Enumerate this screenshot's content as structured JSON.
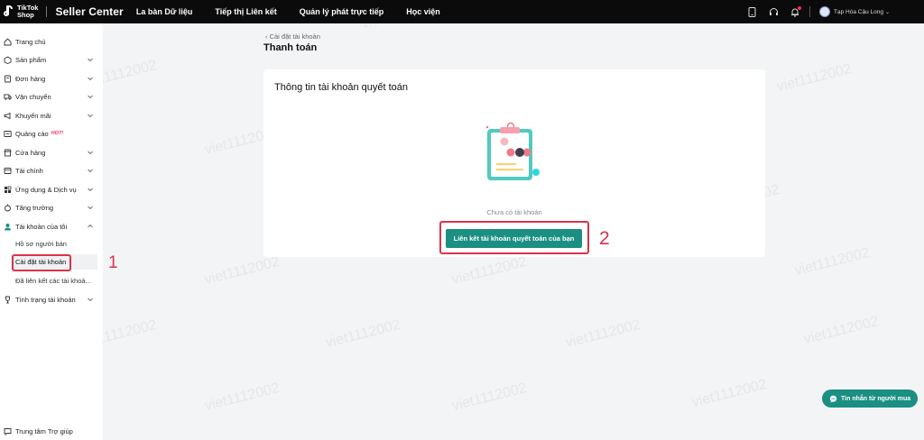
{
  "header": {
    "logo_line1": "TikTok",
    "logo_line2": "Shop",
    "brand_title": "Seller Center",
    "nav": [
      "La bàn Dữ liệu",
      "Tiếp thị Liên kết",
      "Quản lý phát trực tiếp",
      "Học viện"
    ],
    "user_name": "Tạp Hóa Cậu Long"
  },
  "sidebar": {
    "items": [
      {
        "label": "Trang chủ",
        "icon": "home-icon"
      },
      {
        "label": "Sản phẩm",
        "icon": "product-icon"
      },
      {
        "label": "Đơn hàng",
        "icon": "order-icon"
      },
      {
        "label": "Vận chuyển",
        "icon": "truck-icon"
      },
      {
        "label": "Khuyến mãi",
        "icon": "megaphone-icon"
      },
      {
        "label": "Quảng cáo",
        "icon": "ads-icon",
        "badge": "HOT!"
      },
      {
        "label": "Cửa hàng",
        "icon": "store-icon"
      },
      {
        "label": "Tài chính",
        "icon": "finance-icon"
      },
      {
        "label": "Ứng dụng & Dịch vụ",
        "icon": "apps-icon"
      },
      {
        "label": "Tăng trưởng",
        "icon": "growth-icon"
      },
      {
        "label": "Tài khoản của tôi",
        "icon": "user-icon"
      }
    ],
    "sub_items": [
      "Hồ sơ người bán",
      "Cài đặt tài khoản",
      "Đã liên kết các tài khoả..."
    ],
    "status_item": "Tình trạng tài khoản",
    "help": "Trung tâm Trợ giúp"
  },
  "main": {
    "breadcrumb": "Cài đặt tài khoản",
    "page_title": "Thanh toán",
    "card_title": "Thông tin tài khoản quyết toán",
    "empty_text": "Chưa có tài khoản",
    "cta_label": "Liên kết tài khoản quyết toán của bạn"
  },
  "annotations": [
    "1",
    "2"
  ],
  "watermark": "viet1112002",
  "chat_label": "Tin nhắn từ người mua",
  "colors": {
    "accent": "#1a8f82",
    "highlight": "#d8344a",
    "topbar": "#0b0b0b",
    "hot": "#fe2c55"
  }
}
